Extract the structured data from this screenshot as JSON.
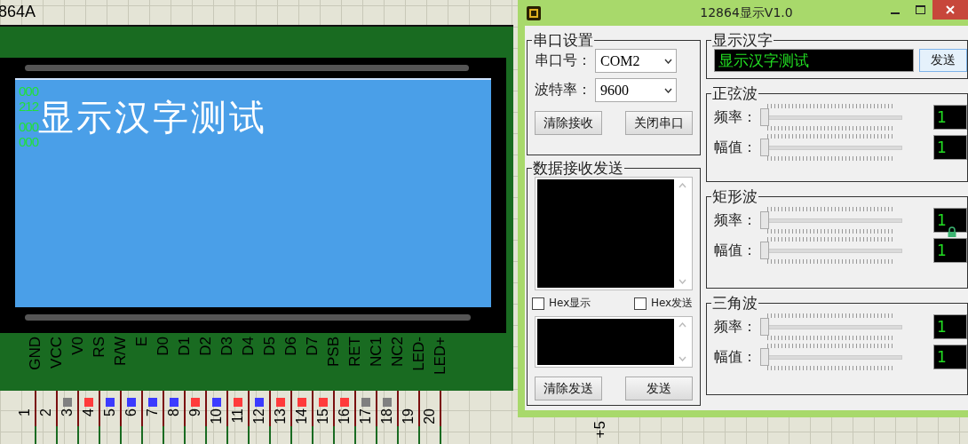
{
  "schematic": {
    "part_label": "864A",
    "lcd": {
      "status_numbers": [
        "000",
        "212",
        "000",
        "000"
      ],
      "display_text": "显示汉字测试"
    },
    "pins": [
      {
        "name": "GND",
        "number": "1"
      },
      {
        "name": "VCC",
        "number": "2"
      },
      {
        "name": "V0",
        "number": "3",
        "color": "#808080"
      },
      {
        "name": "RS",
        "number": "4",
        "color": "#ff3b3b"
      },
      {
        "name": "R/W",
        "number": "5",
        "color": "#3b3bff"
      },
      {
        "name": "E",
        "number": "6",
        "color": "#3b3bff"
      },
      {
        "name": "D0",
        "number": "7",
        "color": "#3b3bff"
      },
      {
        "name": "D1",
        "number": "8",
        "color": "#3b3bff"
      },
      {
        "name": "D2",
        "number": "9",
        "color": "#ff3b3b"
      },
      {
        "name": "D3",
        "number": "10",
        "color": "#3b3bff"
      },
      {
        "name": "D4",
        "number": "11",
        "color": "#ff3b3b"
      },
      {
        "name": "D5",
        "number": "12",
        "color": "#3b3bff"
      },
      {
        "name": "D6",
        "number": "13",
        "color": "#ff3b3b"
      },
      {
        "name": "D7",
        "number": "14",
        "color": "#ff3b3b"
      },
      {
        "name": "PSB",
        "number": "15",
        "color": "#ff3b3b"
      },
      {
        "name": "RET",
        "number": "16",
        "color": "#ff3b3b"
      },
      {
        "name": "NC1",
        "number": "17",
        "color": "#808080"
      },
      {
        "name": "NC2",
        "number": "18",
        "color": "#808080"
      },
      {
        "name": "LED-",
        "number": "19"
      },
      {
        "name": "LED+",
        "number": "20"
      }
    ],
    "net_label": "+5"
  },
  "window": {
    "title": "12864显示V1.0",
    "serial_settings": {
      "title": "串口设置",
      "port_label": "串口号：",
      "port_value": "COM2",
      "baud_label": "波特率：",
      "baud_value": "9600",
      "buttons": [
        "清除接收",
        "关闭串口"
      ]
    },
    "data_io": {
      "title": "数据接收发送",
      "checkboxes": [
        {
          "label": "Hex显示",
          "checked": false
        },
        {
          "label": "Hex发送",
          "checked": false
        }
      ],
      "buttons": [
        "清除发送",
        "发送"
      ]
    },
    "display_text": {
      "title": "显示汉字",
      "value": "显示汉字测试",
      "button": "发送"
    },
    "waves": [
      {
        "title": "正弦波",
        "controls": [
          {
            "label": "频率：",
            "level": 0,
            "value": "1"
          },
          {
            "label": "幅值：",
            "level": 0,
            "value": "1"
          }
        ]
      },
      {
        "title": "矩形波",
        "controls": [
          {
            "label": "频率：",
            "level": 0,
            "value": "1",
            "locked": true
          },
          {
            "label": "幅值：",
            "level": 0,
            "value": "1"
          }
        ]
      },
      {
        "title": "三角波",
        "controls": [
          {
            "label": "频率：",
            "level": 0,
            "value": "1"
          },
          {
            "label": "幅值：",
            "level": 0,
            "value": "1"
          }
        ]
      }
    ]
  }
}
